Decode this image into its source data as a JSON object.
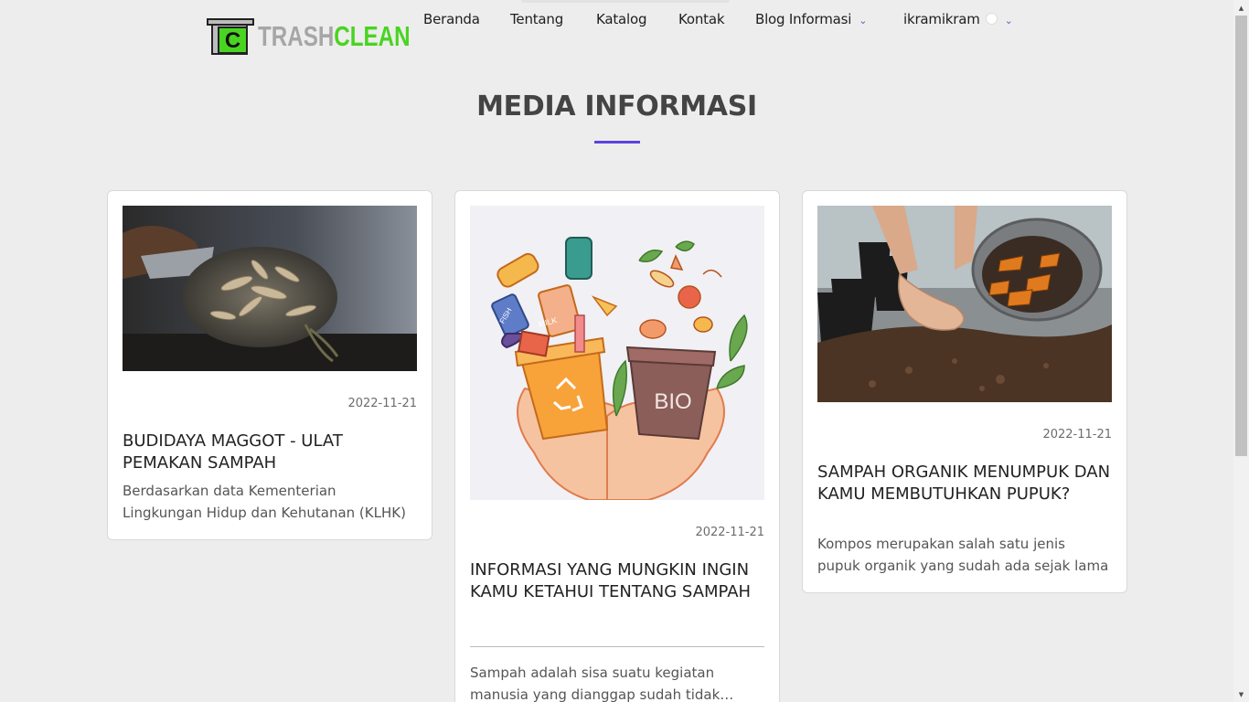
{
  "brand": {
    "part1": "TRASH",
    "part2": "CLEAN",
    "mark_letter": "C"
  },
  "nav": {
    "items": [
      {
        "label": "Beranda"
      },
      {
        "label": "Tentang"
      },
      {
        "label": "Katalog"
      },
      {
        "label": "Kontak"
      },
      {
        "label": "Blog Informasi",
        "dropdown": true
      }
    ],
    "user": {
      "name": "ikramikram"
    }
  },
  "page_title": "MEDIA INFORMASI",
  "colors": {
    "accent": "#5a44e0",
    "brand_green": "#49d421",
    "brand_grey": "#a6a6a6"
  },
  "cards": [
    {
      "image_icon": "maggot-compost-photo",
      "date": "2022-11-21",
      "title": "BUDIDAYA MAGGOT - ULAT PEMAKAN SAMPAH",
      "excerpt": "Berdasarkan data Kementerian Lingkungan Hidup dan Kehutanan (KLHK)"
    },
    {
      "image_icon": "recycle-bio-bins-illustration",
      "date": "2022-11-21",
      "title": "INFORMASI YANG MUNGKIN INGIN KAMU KETAHUI TENTANG SAMPAH",
      "excerpt": "Sampah adalah sisa suatu kegiatan manusia yang dianggap sudah tidak berguna",
      "illustration_labels": {
        "bio": "BIO",
        "milk": "MILK",
        "fish": "FISH"
      }
    },
    {
      "image_icon": "organic-compost-photo",
      "date": "2022-11-21",
      "title": "SAMPAH ORGANIK MENUMPUK DAN KAMU MEMBUTUHKAN PUPUK?",
      "excerpt": "Kompos merupakan salah satu jenis pupuk organik yang sudah ada sejak lama"
    }
  ]
}
